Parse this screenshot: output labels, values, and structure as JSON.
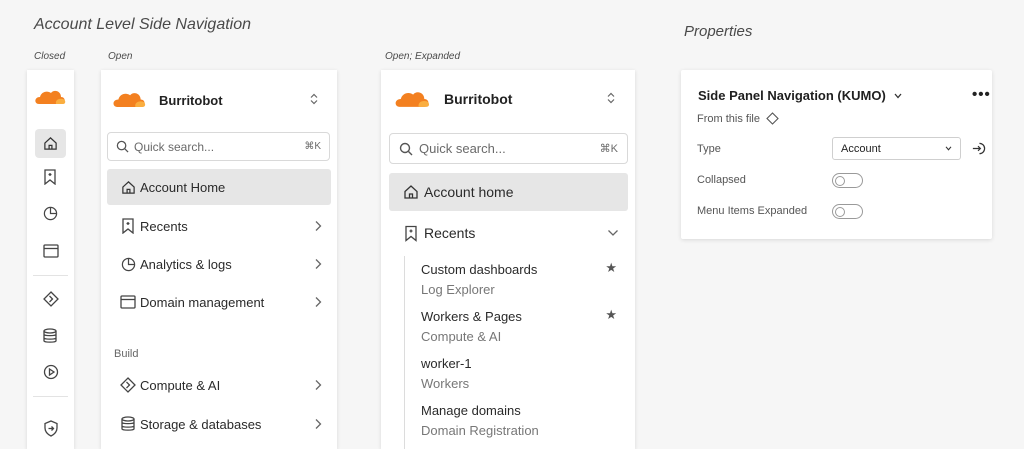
{
  "headings": {
    "main": "Account Level Side Navigation",
    "closed": "Closed",
    "open": "Open",
    "open_expanded": "Open; Expanded",
    "properties": "Properties"
  },
  "colors": {
    "logo_orange": "#f38020",
    "logo_light": "#faae40",
    "active_bg": "#e6e6e6",
    "border": "#d9d9d9"
  },
  "closed_nav": {
    "icons": [
      "logo-icon",
      "home-icon",
      "bookmark-icon",
      "analytics-icon",
      "domain-icon",
      "compute-icon",
      "storage-icon",
      "media-icon",
      "security-icon"
    ]
  },
  "open_nav": {
    "account_name": "Burritobot",
    "search_placeholder": "Quick search...",
    "search_shortcut": "⌘K",
    "items": [
      {
        "label": "Account Home",
        "icon": "home-icon"
      },
      {
        "label": "Recents",
        "icon": "bookmark-icon"
      },
      {
        "label": "Analytics & logs",
        "icon": "analytics-icon"
      },
      {
        "label": "Domain management",
        "icon": "domain-icon"
      }
    ],
    "section_label": "Build",
    "build_items": [
      {
        "label": "Compute & AI",
        "icon": "compute-icon"
      },
      {
        "label": "Storage & databases",
        "icon": "storage-icon"
      }
    ]
  },
  "expanded_nav": {
    "account_name": "Burritobot",
    "search_placeholder": "Quick search...",
    "search_shortcut": "⌘K",
    "home_label": "Account home",
    "recents_label": "Recents",
    "recents": [
      {
        "title": "Custom dashboards",
        "subtitle": "Log Explorer",
        "starred": true
      },
      {
        "title": "Workers & Pages",
        "subtitle": "Compute & AI",
        "starred": true
      },
      {
        "title": "worker-1",
        "subtitle": "Workers",
        "starred": false
      },
      {
        "title": "Manage domains",
        "subtitle": "Domain Registration",
        "starred": false
      }
    ]
  },
  "properties": {
    "component_name": "Side Panel Navigation (KUMO)",
    "source_label": "From this file",
    "type_label": "Type",
    "type_value": "Account",
    "collapsed_label": "Collapsed",
    "collapsed_value": false,
    "menu_expanded_label": "Menu Items Expanded",
    "menu_expanded_value": false
  }
}
